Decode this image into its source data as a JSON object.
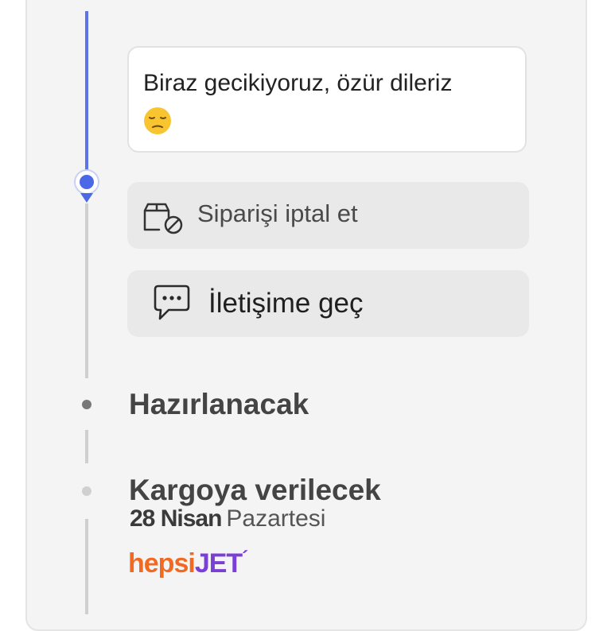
{
  "message": {
    "text": "Biraz gecikiyoruz, özür dileriz",
    "emoji_name": "pensive-face-emoji"
  },
  "actions": {
    "cancel_order_label": "Siparişi iptal et",
    "cancel_order_icon": "box-cancel-icon",
    "contact_label": "İletişime geç",
    "contact_icon": "chat-bubble-icon"
  },
  "timeline": {
    "active_color": "#5b74e8",
    "steps": [
      {
        "title": "Hazırlanacak"
      },
      {
        "title": "Kargoya verilecek",
        "date": "28 Nisan",
        "day": "Pazartesi"
      }
    ]
  },
  "carrier": {
    "brand_part1": "hepsi",
    "brand_part2": "JET",
    "brand_mark": "´",
    "color1": "#f26a21",
    "color2": "#7a3fd6"
  }
}
